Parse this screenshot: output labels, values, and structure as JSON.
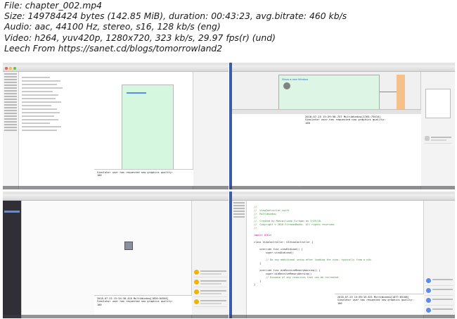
{
  "info": {
    "lines": [
      "File: chapter_002.mp4",
      "Size: 149784424 bytes (142.85 MiB), duration: 00:43:23, avg.bitrate: 460 kb/s",
      "Audio: aac, 44100 Hz, stereo, s16, 128 kb/s (eng)",
      "Video: h264, yuv420p, 1280x720, 323 kb/s, 29.97 fps(r) (und)",
      "Leech From https://sanet.cd/blogs/tomorrowland2"
    ]
  },
  "thumbs": {
    "t1": {
      "console": "Simulator user has requested new graphics quality:\n100"
    },
    "t2": {
      "canvas_label": "Show a new Window",
      "console": "2018-07-25 15:29:58.757 MultiWindow[1765:75434]\nSimulator user has requested new graphics quality:\n100"
    },
    "t3": {
      "console": "2018-07-25 15:34:38.428 MultiWindow[1820:84504]\nSimulator user has requested new graphics quality:\n100"
    },
    "t4": {
      "code": [
        "//",
        "//  ViewController.swift",
        "//  MultiWindow",
        "//",
        "//  Created by Maximiliano Firtman on 7/25/18.",
        "//  Copyright © 2018 FirtmanBooks. All rights reserved.",
        "//",
        "",
        "import UIKit",
        "",
        "class ViewController: UIViewController {",
        "",
        "    override func viewDidLoad() {",
        "        super.viewDidLoad()",
        "",
        "        // Do any additional setup after loading the view, typically from a nib.",
        "    }",
        "",
        "    override func didReceiveMemoryWarning() {",
        "        super.didReceiveMemoryWarning()",
        "        // Dispose of any resources that can be recreated.",
        "    }",
        "}"
      ],
      "console": "2018-07-25 15:36:35.421 MultiWindow[1877:85108]\nSimulator user has requested new graphics quality:\n100"
    }
  },
  "colors": {
    "sim_green": "#d6f7df",
    "sim_blue": "#2f6bd8",
    "canvas_green": "#dcf5e4",
    "canvas_orange": "#f5c08a",
    "desktop_blue": "#3b5ca8"
  }
}
